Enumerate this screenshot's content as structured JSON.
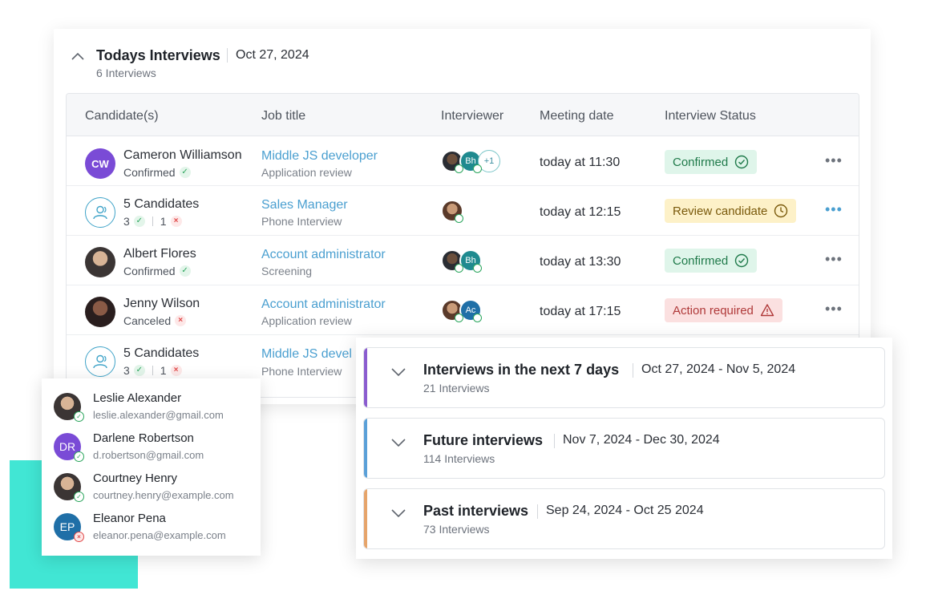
{
  "today": {
    "title": "Todays Interviews",
    "date": "Oct 27, 2024",
    "count": "6 Interviews"
  },
  "table": {
    "headers": [
      "Candidate(s)",
      "Job title",
      "Interviewer",
      "Meeting date",
      "Interview Status"
    ],
    "rows": [
      {
        "avatar_initials": "CW",
        "name": "Cameron Williamson",
        "sub": "Confirmed",
        "job": "Middle JS developer",
        "stage": "Application review",
        "interviewers": [
          "",
          "Bh",
          "+1"
        ],
        "meeting": "today at 11:30",
        "status": "Confirmed",
        "more": "•••"
      },
      {
        "name": "5 Candidates",
        "accepted": "3",
        "rejected": "1",
        "job": "Sales Manager",
        "stage": "Phone Interview",
        "meeting": "today at 12:15",
        "status": "Review candidate",
        "more": "•••"
      },
      {
        "name": "Albert Flores",
        "sub": "Confirmed",
        "job": "Account administrator",
        "stage": "Screening",
        "interviewers": [
          "",
          "Bh"
        ],
        "meeting": "today at 13:30",
        "status": "Confirmed",
        "more": "•••"
      },
      {
        "name": "Jenny Wilson",
        "sub": "Canceled",
        "job": "Account administrator",
        "stage": "Application review",
        "interviewers": [
          "",
          "Ac"
        ],
        "meeting": "today at 17:15",
        "status": "Action required",
        "more": "•••"
      },
      {
        "name": "5 Candidates",
        "accepted": "3",
        "rejected": "1",
        "job": "Middle JS devel",
        "stage": "Phone Interview"
      }
    ]
  },
  "popup": {
    "people": [
      {
        "name": "Leslie Alexander",
        "email": "leslie.alexander@gmail.com"
      },
      {
        "initials": "DR",
        "name": "Darlene Robertson",
        "email": "d.robertson@gmail.com"
      },
      {
        "name": "Courtney Henry",
        "email": "courtney.henry@example.com"
      },
      {
        "initials": "EP",
        "name": "Eleanor Pena",
        "email": "eleanor.pena@example.com"
      }
    ]
  },
  "sections": [
    {
      "title": "Interviews in the next 7 days",
      "dates": "Oct 27, 2024 - Nov 5, 2024",
      "count": "21 Interviews",
      "accent": "#8a5ccf"
    },
    {
      "title": "Future interviews",
      "dates": "Nov 7, 2024 - Dec 30, 2024",
      "count": "114 Interviews",
      "accent": "#5aa0d8"
    },
    {
      "title": "Past interviews",
      "dates": "Sep 24, 2024 - Oct 25 2024",
      "count": "73 Interviews",
      "accent": "#e6a46a"
    }
  ],
  "colors": {
    "teal_block": "#41e6d4",
    "link_blue": "#4a9fd0",
    "status_green_bg": "#dff5ea",
    "status_yellow_bg": "#fdf1c8",
    "status_red_bg": "#fbe0e0"
  }
}
